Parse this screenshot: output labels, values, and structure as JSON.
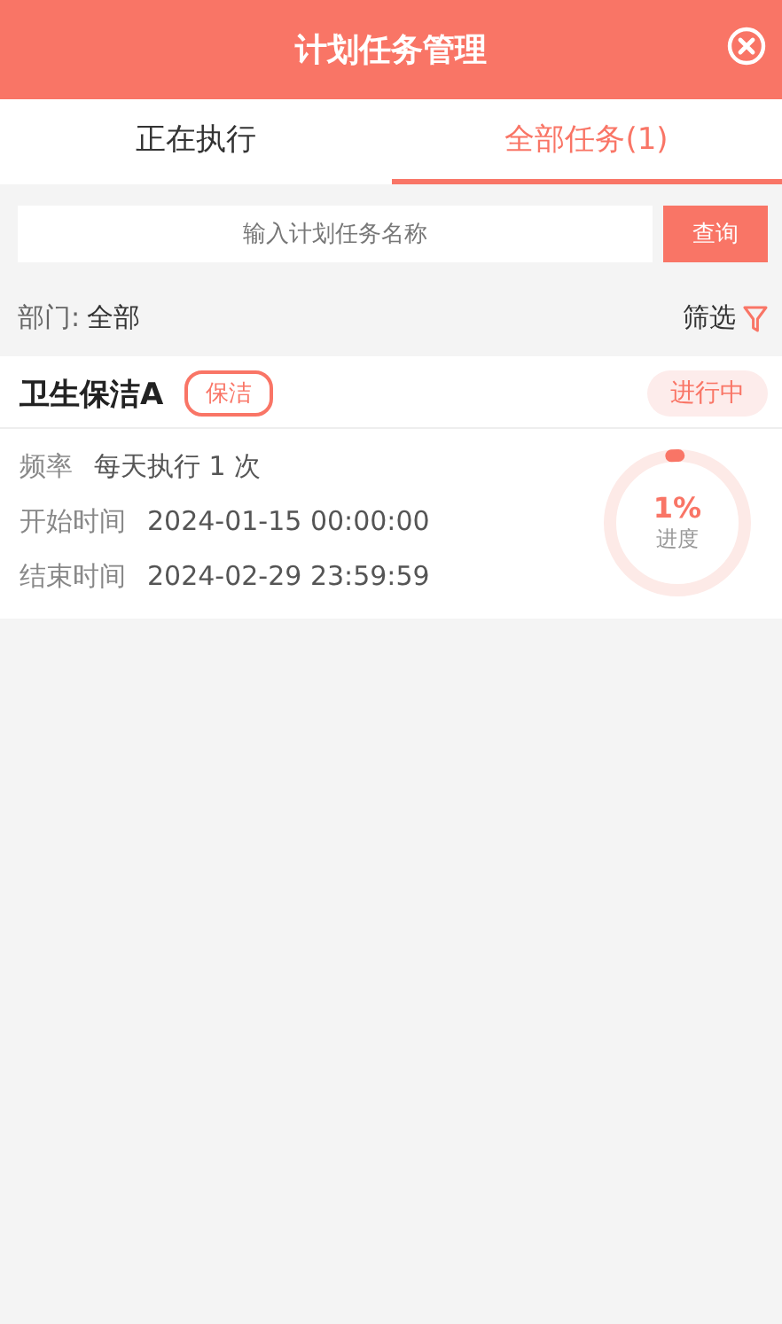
{
  "header": {
    "title": "计划任务管理"
  },
  "tabs": [
    {
      "label": "正在执行",
      "selected": false
    },
    {
      "label": "全部任务(1)",
      "selected": true
    }
  ],
  "search": {
    "placeholder": "输入计划任务名称",
    "button": "查询"
  },
  "filter_bar": {
    "label": "部门:",
    "value": "全部",
    "filter": "筛选"
  },
  "tasks": [
    {
      "name": "卫生保洁A",
      "tag": "保洁",
      "status": "进行中",
      "fields": [
        {
          "label": "频率",
          "value": "每天执行 1 次"
        },
        {
          "label": "开始时间",
          "value": "2024-01-15 00:00:00"
        },
        {
          "label": "结束时间",
          "value": "2024-02-29 23:59:59"
        }
      ],
      "progress": {
        "level": 0.01,
        "percent": "1%",
        "label": "进度"
      }
    }
  ]
}
